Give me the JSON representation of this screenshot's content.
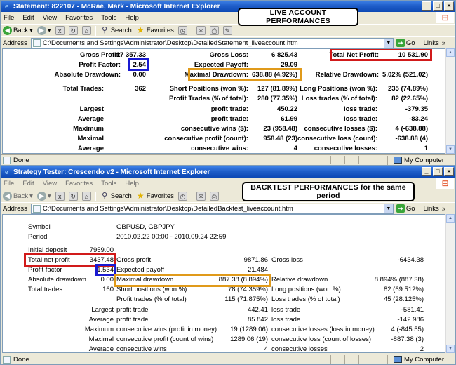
{
  "colors": {
    "title_gradient": "#1f5ec9",
    "highlight_red": "#d11a1a",
    "highlight_blue": "#1a1ad1",
    "highlight_orange": "#e09a1a"
  },
  "live": {
    "title": "Statement: 822107 - McRae, Mark - Microsoft Internet Explorer",
    "menu": [
      "File",
      "Edit",
      "View",
      "Favorites",
      "Tools",
      "Help"
    ],
    "toolbar": {
      "back": "Back",
      "search": "Search",
      "favorites": "Favorites"
    },
    "address_label": "Address",
    "address": "C:\\Documents and Settings\\Administrator\\Desktop\\DetailedStatement_liveaccount.htm",
    "go": "Go",
    "links": "Links",
    "banner": "LIVE ACCOUNT PERFORMANCES",
    "status": "Done",
    "zone": "My Computer",
    "stats": {
      "gross_profit_label": "Gross Profit:",
      "gross_profit": "17 357.33",
      "gross_loss_label": "Gross Loss:",
      "gross_loss": "6 825.43",
      "total_net_profit_label": "Total Net Profit:",
      "total_net_profit": "10 531.90",
      "profit_factor_label": "Profit Factor:",
      "profit_factor": "2.54",
      "expected_payoff_label": "Expected Payoff:",
      "expected_payoff": "29.09",
      "abs_dd_label": "Absolute Drawdown:",
      "abs_dd": "0.00",
      "max_dd_label": "Maximal Drawdown:",
      "max_dd": "638.88 (4.92%)",
      "rel_dd_label": "Relative Drawdown:",
      "rel_dd": "5.02% (521.02)",
      "total_trades_label": "Total Trades:",
      "total_trades": "362",
      "short_label": "Short Positions (won %):",
      "short": "127 (81.89%)",
      "long_label": "Long Positions (won %):",
      "long": "235 (74.89%)",
      "profit_trades_label": "Profit Trades (% of total):",
      "profit_trades": "280 (77.35%)",
      "loss_trades_label": "Loss trades (% of total):",
      "loss_trades": "82 (22.65%)",
      "largest": "Largest",
      "largest_profit_label": "profit trade:",
      "largest_profit": "450.22",
      "largest_loss_label": "loss trade:",
      "largest_loss": "-379.35",
      "average": "Average",
      "avg_profit_label": "profit trade:",
      "avg_profit": "61.99",
      "avg_loss_label": "loss trade:",
      "avg_loss": "-83.24",
      "maximum": "Maximum",
      "max_wins_label": "consecutive wins ($):",
      "max_wins": "23 (958.48)",
      "max_losses_label": "consecutive losses ($):",
      "max_losses": "4 (-638.88)",
      "maximal": "Maximal",
      "maximal_profit_label": "consecutive profit (count):",
      "maximal_profit": "958.48 (23)",
      "maximal_loss_label": "consecutive loss (count):",
      "maximal_loss": "-638.88 (4)",
      "average2": "Average",
      "avg_wins_label": "consecutive wins:",
      "avg_wins": "4",
      "avg_losses_label": "consecutive losses:",
      "avg_losses": "1"
    }
  },
  "backtest": {
    "title": "Strategy Tester: Crescendo v2 - Microsoft Internet Explorer",
    "menu": [
      "File",
      "Edit",
      "View",
      "Favorites",
      "Tools",
      "Help"
    ],
    "toolbar": {
      "back": "Back",
      "search": "Search",
      "favorites": "Favorites"
    },
    "address_label": "Address",
    "address": "C:\\Documents and Settings\\Administrator\\Desktop\\DetailedBacktest_liveaccount.htm",
    "go": "Go",
    "links": "Links",
    "banner": "BACKTEST PERFORMANCES for the same period",
    "status": "Done",
    "zone": "My Computer",
    "stats": {
      "symbol_label": "Symbol",
      "symbol": "GBPUSD, GBPJPY",
      "period_label": "Period",
      "period": "2010.02.22 00:00 - 2010.09.24 22:59",
      "initial_deposit_label": "Initial deposit",
      "initial_deposit": "7959.00",
      "total_net_profit_label": "Total net profit",
      "total_net_profit": "3437.48",
      "gross_profit_label": "Gross profit",
      "gross_profit": "9871.86",
      "gross_loss_label": "Gross loss",
      "gross_loss": "-6434.38",
      "profit_factor_label": "Profit factor",
      "profit_factor": "1.534",
      "expected_payoff_label": "Expected payoff",
      "expected_payoff": "21.484",
      "abs_dd_label": "Absolute drawdown",
      "abs_dd": "0.00",
      "max_dd_label": "Maximal drawdown",
      "max_dd": "887.38 (8.894%)",
      "rel_dd_label": "Relative drawdown",
      "rel_dd": "8.894% (887.38)",
      "total_trades_label": "Total trades",
      "total_trades": "160",
      "short_label": "Short positions (won %)",
      "short": "78 (74.359%)",
      "long_label": "Long positions (won %)",
      "long": "82 (69.512%)",
      "profit_trades_label": "Profit trades (% of total)",
      "profit_trades": "115 (71.875%)",
      "loss_trades_label": "Loss trades (% of total)",
      "loss_trades": "45 (28.125%)",
      "largest": "Largest",
      "largest_profit_label": "profit trade",
      "largest_profit": "442.41",
      "largest_loss_label": "loss trade",
      "largest_loss": "-581.41",
      "average": "Average",
      "avg_profit_label": "profit trade",
      "avg_profit": "85.842",
      "avg_loss_label": "loss trade",
      "avg_loss": "-142.986",
      "maximum": "Maximum",
      "max_wins_label": "consecutive wins (profit in money)",
      "max_wins": "19 (1289.06)",
      "max_losses_label": "consecutive losses (loss in money)",
      "max_losses": "4 (-845.55)",
      "maximal": "Maximal",
      "maximal_profit_label": "consecutive profit (count of wins)",
      "maximal_profit": "1289.06 (19)",
      "maximal_loss_label": "consecutive loss (count of losses)",
      "maximal_loss": "-887.38 (3)",
      "average2": "Average",
      "avg_wins_label": "consecutive wins",
      "avg_wins": "4",
      "avg_losses_label": "consecutive losses",
      "avg_losses": "2"
    }
  }
}
